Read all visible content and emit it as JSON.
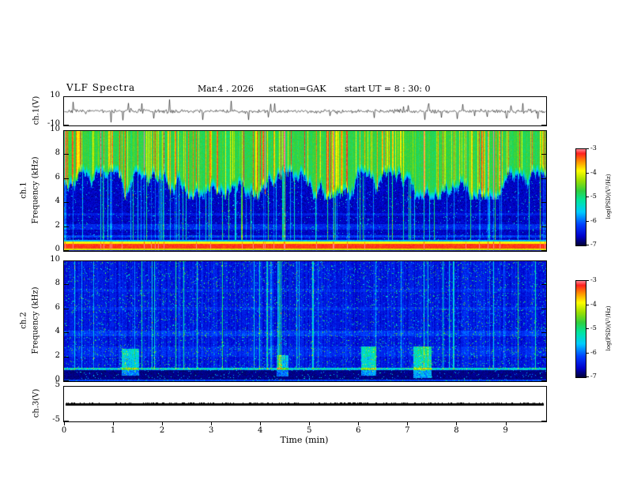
{
  "header": {
    "title": "VLF Spectra",
    "date": "Mar.4 . 2026",
    "station": "station=GAK",
    "start_ut": "start UT =  8 : 30: 0"
  },
  "x_axis": {
    "label": "Time (min)",
    "min": 0,
    "max": 9.83,
    "ticks": [
      0,
      1,
      2,
      3,
      4,
      5,
      6,
      7,
      8,
      9
    ]
  },
  "panels": {
    "wave": {
      "ylabel": "ch.1(V)",
      "ymin": -10,
      "ymax": 10,
      "yticks": [
        10,
        -10
      ]
    },
    "spec1": {
      "channel": "ch.1",
      "freq_label": "Frequency (kHz)",
      "ymin": 0,
      "ymax": 10,
      "yticks": [
        0,
        2,
        4,
        6,
        8,
        10
      ]
    },
    "spec2": {
      "channel": "ch.2",
      "freq_label": "Frequency (kHz)",
      "ymin": 0,
      "ymax": 10,
      "yticks": [
        0,
        2,
        4,
        6,
        8,
        10
      ]
    },
    "ch3": {
      "ylabel": "ch.3(V)",
      "ymin": -5,
      "ymax": 5,
      "yticks": [
        5,
        -5
      ]
    }
  },
  "colorbar": {
    "label": "log(PSD)(V²/Hz)",
    "min": -7,
    "max": -3,
    "ticks": [
      -3,
      -4,
      -5,
      -6,
      -7
    ]
  },
  "chart_data": [
    {
      "type": "line",
      "title": "ch.1 time series",
      "xlabel": "Time (min)",
      "ylabel": "ch.1(V)",
      "x_range": [
        0,
        9.83
      ],
      "y_range": [
        -10,
        10
      ],
      "description": "Black broadband noise trace centered on 0 V with ~±2 V envelope and frequent impulsive spikes reaching about ±9 V over the whole 0–9.8 min record."
    },
    {
      "type": "heatmap",
      "title": "ch.1 VLF spectrogram",
      "xlabel": "Time (min)",
      "ylabel": "Frequency (kHz)",
      "x_range": [
        0,
        9.83
      ],
      "y_range": [
        0,
        10
      ],
      "z_label": "log(PSD)(V²/Hz)",
      "z_range": [
        -7,
        -3
      ],
      "features": [
        "5.5–10 kHz: continuous green band near -4.5 with dense yellow/red vertical striations up to -3",
        "1–5.5 kHz: dark blue/black background near -6.5 to -7 crossed by vertical cyan impulsive streaks",
        "jagged irregular lower boundary of the green band near 5–6 kHz",
        "0.2–0.8 kHz: intense red/yellow horizontal band near -3 spanning all times",
        "weak enhanced horizontal lines near 1.2 and 2 kHz"
      ]
    },
    {
      "type": "heatmap",
      "title": "ch.2 VLF spectrogram",
      "xlabel": "Time (min)",
      "ylabel": "Frequency (kHz)",
      "x_range": [
        0,
        9.83
      ],
      "y_range": [
        0,
        10
      ],
      "z_label": "log(PSD)(V²/Hz)",
      "z_range": [
        -7,
        -3
      ],
      "features": [
        "overall dark blue background near -6 to -6.5 with scattered cyan speckles",
        "many vertical cyan/green impulsive streaks across 0–10 kHz",
        "below 1 kHz: very dark band with a bright enhanced line near 1 kHz",
        "green patches near 1.3, 4.5, 6.2 and 7.3 min at 1–3 kHz",
        "faint horizontal enhancements near 2.5, 4, 6 and 7.5 kHz"
      ]
    },
    {
      "type": "line",
      "title": "ch.3 time series",
      "xlabel": "Time (min)",
      "ylabel": "ch.3(V)",
      "x_range": [
        0,
        9.83
      ],
      "y_range": [
        -5,
        5
      ],
      "description": "Thick flat black trace at approximately 0 V for the entire record."
    }
  ],
  "render": {
    "colormap_anchors": [
      [
        0.0,
        "#020230"
      ],
      [
        0.1,
        "#0000cc"
      ],
      [
        0.22,
        "#0040ff"
      ],
      [
        0.35,
        "#00ccff"
      ],
      [
        0.47,
        "#00e6a0"
      ],
      [
        0.57,
        "#2fd040"
      ],
      [
        0.68,
        "#9fe000"
      ],
      [
        0.78,
        "#ffff00"
      ],
      [
        0.88,
        "#ff8c00"
      ],
      [
        0.96,
        "#ff2020"
      ],
      [
        1.0,
        "#ff7f8c"
      ]
    ],
    "seeds": {
      "wave": 7,
      "spec1": 13,
      "spec2": 29,
      "ch3": 3
    },
    "wave": {
      "sigma": 1.1,
      "spike_prob": 0.05,
      "spike_min": 3,
      "spike_max": 7.5
    },
    "spec1": {
      "top_base": 0.56,
      "boundary_min": 4.3,
      "boundary_max": 6.6,
      "top_streak_prob": 0.25,
      "red_streak_prob": 0.06,
      "blue_base": 0.06,
      "blue_streak_prob": 0.12,
      "bands": [
        {
          "f0": 0.25,
          "f1": 0.6,
          "t": 0.94
        },
        {
          "f0": 0.6,
          "f1": 0.8,
          "t": 0.78
        },
        {
          "f0": 0.12,
          "f1": 0.25,
          "t": 0.74
        },
        {
          "f0": 0.8,
          "f1": 0.95,
          "t": 0.33
        },
        {
          "f0": 0.0,
          "f1": 0.12,
          "t": 0.1
        }
      ],
      "lines": [
        {
          "f": 1.25,
          "hw": 0.1,
          "dt": 0.14
        },
        {
          "f": 2.05,
          "hw": 0.22,
          "dt": 0.1
        },
        {
          "f": 3.1,
          "hw": 0.12,
          "dt": 0.07
        }
      ]
    },
    "spec2": {
      "base": 0.09,
      "col_var": 0.08,
      "speckle_prob": 0.05,
      "streak_prob": 0.07,
      "dark_below_khz": 1.0,
      "lines": [
        {
          "f": 1.07,
          "hw": 0.09,
          "dt": 0.36
        },
        {
          "f": 2.5,
          "hw": 0.45,
          "dt": 0.05
        },
        {
          "f": 4.0,
          "hw": 0.22,
          "dt": 0.08
        },
        {
          "f": 6.1,
          "hw": 0.15,
          "dt": 0.05
        },
        {
          "f": 7.6,
          "hw": 0.15,
          "dt": 0.04
        }
      ],
      "patches": [
        {
          "x": 1.35,
          "f": 1.6,
          "dx": 0.18,
          "df": 1.1,
          "dt": 0.3
        },
        {
          "x": 4.45,
          "f": 1.3,
          "dx": 0.12,
          "df": 0.9,
          "dt": 0.28
        },
        {
          "x": 6.2,
          "f": 1.7,
          "dx": 0.15,
          "df": 1.2,
          "dt": 0.34
        },
        {
          "x": 7.3,
          "f": 1.6,
          "dx": 0.18,
          "df": 1.3,
          "dt": 0.36
        }
      ]
    },
    "ch3": {
      "value": 0,
      "thickness_px": 3,
      "x_end_min": 9.78
    }
  }
}
